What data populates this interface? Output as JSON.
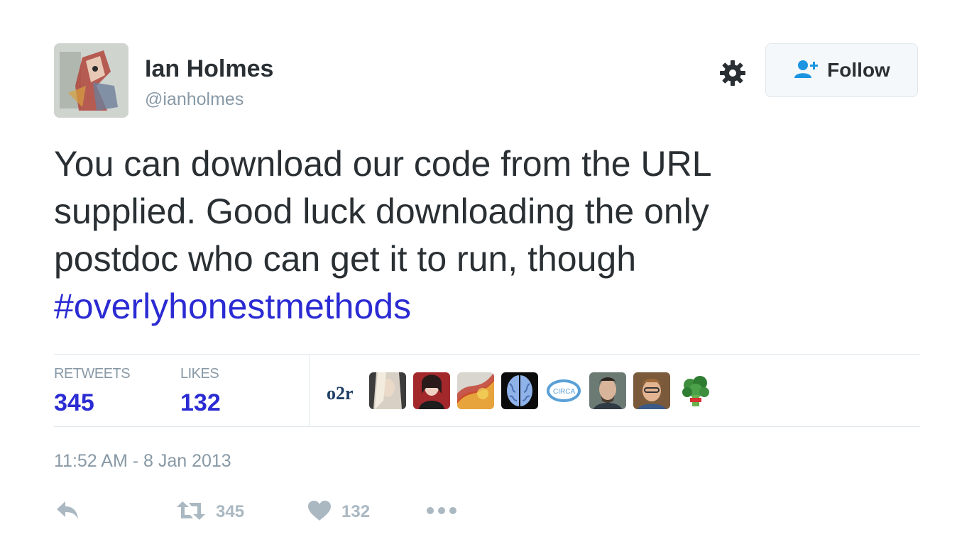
{
  "user": {
    "name": "Ian Holmes",
    "handle": "@ianholmes"
  },
  "header": {
    "settings_icon": "gear-icon",
    "follow_label": "Follow",
    "follow_icon": "add-user-icon"
  },
  "tweet": {
    "text_lines": [
      "You can download our code from the URL",
      "supplied. Good luck downloading the only",
      "postdoc who can get it to run, though"
    ],
    "hashtag": "#overlyhonestmethods"
  },
  "stats": {
    "retweets_label": "RETWEETS",
    "retweets_value": "345",
    "likes_label": "LIKES",
    "likes_value": "132"
  },
  "likers": [
    {
      "name": "o2r-logo",
      "text": "o2r"
    },
    {
      "name": "avatar-1"
    },
    {
      "name": "avatar-2"
    },
    {
      "name": "avatar-3"
    },
    {
      "name": "avatar-4"
    },
    {
      "name": "avatar-5",
      "text": "CIRCA"
    },
    {
      "name": "avatar-6"
    },
    {
      "name": "avatar-7"
    },
    {
      "name": "avatar-8"
    }
  ],
  "timestamp": "11:52 AM - 8 Jan 2013",
  "actions": {
    "reply_icon": "reply-icon",
    "retweet_icon": "retweet-icon",
    "retweet_count": "345",
    "like_icon": "heart-icon",
    "like_count": "132",
    "more_icon": "more-icon"
  },
  "colors": {
    "link": "#2b2bd4",
    "text": "#292f33",
    "muted": "#8899a6",
    "icon": "#aab8c2",
    "follow_icon": "#1b95e0"
  }
}
